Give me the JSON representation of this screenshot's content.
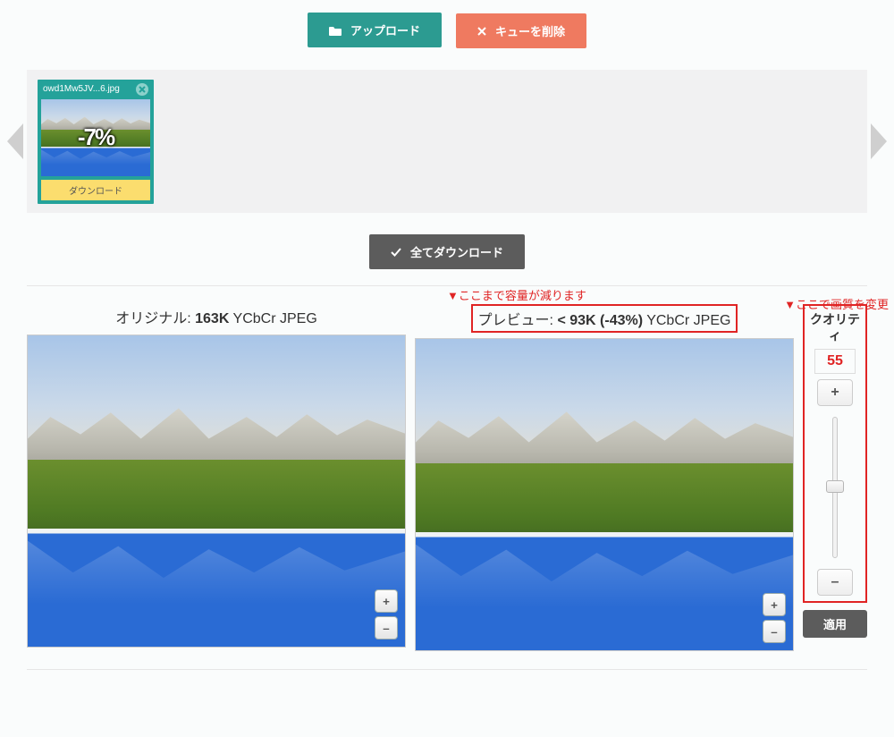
{
  "top": {
    "upload_label": "アップロード",
    "clear_label": "キューを削除"
  },
  "queue": {
    "item": {
      "name": "owd1Mw5JV...6.jpg",
      "percent": "-7%",
      "download_label": "ダウンロード"
    }
  },
  "download_all_label": "全てダウンロード",
  "annotations": {
    "preview_note": "▼ここまで容量が減ります",
    "quality_note": "▼ここで画質を変更"
  },
  "panels": {
    "original": {
      "prefix": "オリジナル: ",
      "size": "163K",
      "suffix": " YCbCr JPEG"
    },
    "preview": {
      "prefix": "プレビュー: ",
      "size": "< 93K (-43%)",
      "suffix": " YCbCr JPEG"
    }
  },
  "quality": {
    "label": "クオリティ",
    "value": "55",
    "apply_label": "適用"
  },
  "icons": {
    "plus": "+",
    "minus": "–"
  }
}
